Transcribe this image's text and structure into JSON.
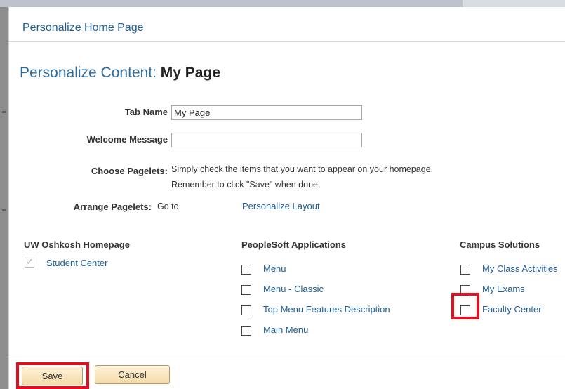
{
  "dialog": {
    "title": "Personalize Home Page"
  },
  "heading": {
    "prefix": "Personalize Content:",
    "name": "My Page"
  },
  "form": {
    "tab_name_label": "Tab Name",
    "tab_name_value": "My Page",
    "welcome_label": "Welcome Message",
    "welcome_value": "",
    "choose_label": "Choose Pagelets:",
    "choose_line1": "Simply check the items that you want to appear on your homepage.",
    "choose_line2": "Remember to click \"Save\" when done.",
    "arrange_label": "Arrange Pagelets:",
    "arrange_goto": "Go to",
    "arrange_link": "Personalize Layout"
  },
  "columns": {
    "uw": {
      "header": "UW Oshkosh Homepage",
      "items": [
        {
          "label": "Student Center",
          "checked": true,
          "disabled": true
        }
      ]
    },
    "peoplesoft": {
      "header": "PeopleSoft Applications",
      "items": [
        {
          "label": "Menu",
          "checked": false
        },
        {
          "label": "Menu - Classic",
          "checked": false
        },
        {
          "label": "Top Menu Features Description",
          "checked": false
        },
        {
          "label": "Main Menu",
          "checked": false
        }
      ]
    },
    "campus": {
      "header": "Campus Solutions",
      "items": [
        {
          "label": "My Class Activities",
          "checked": false
        },
        {
          "label": "My Exams",
          "checked": false
        },
        {
          "label": "Faculty Center",
          "checked": false
        }
      ]
    }
  },
  "buttons": {
    "save": "Save",
    "cancel": "Cancel"
  },
  "colors": {
    "highlight": "#e0101f",
    "link": "#1f5d95",
    "button_fill": "#f4d9a6"
  }
}
